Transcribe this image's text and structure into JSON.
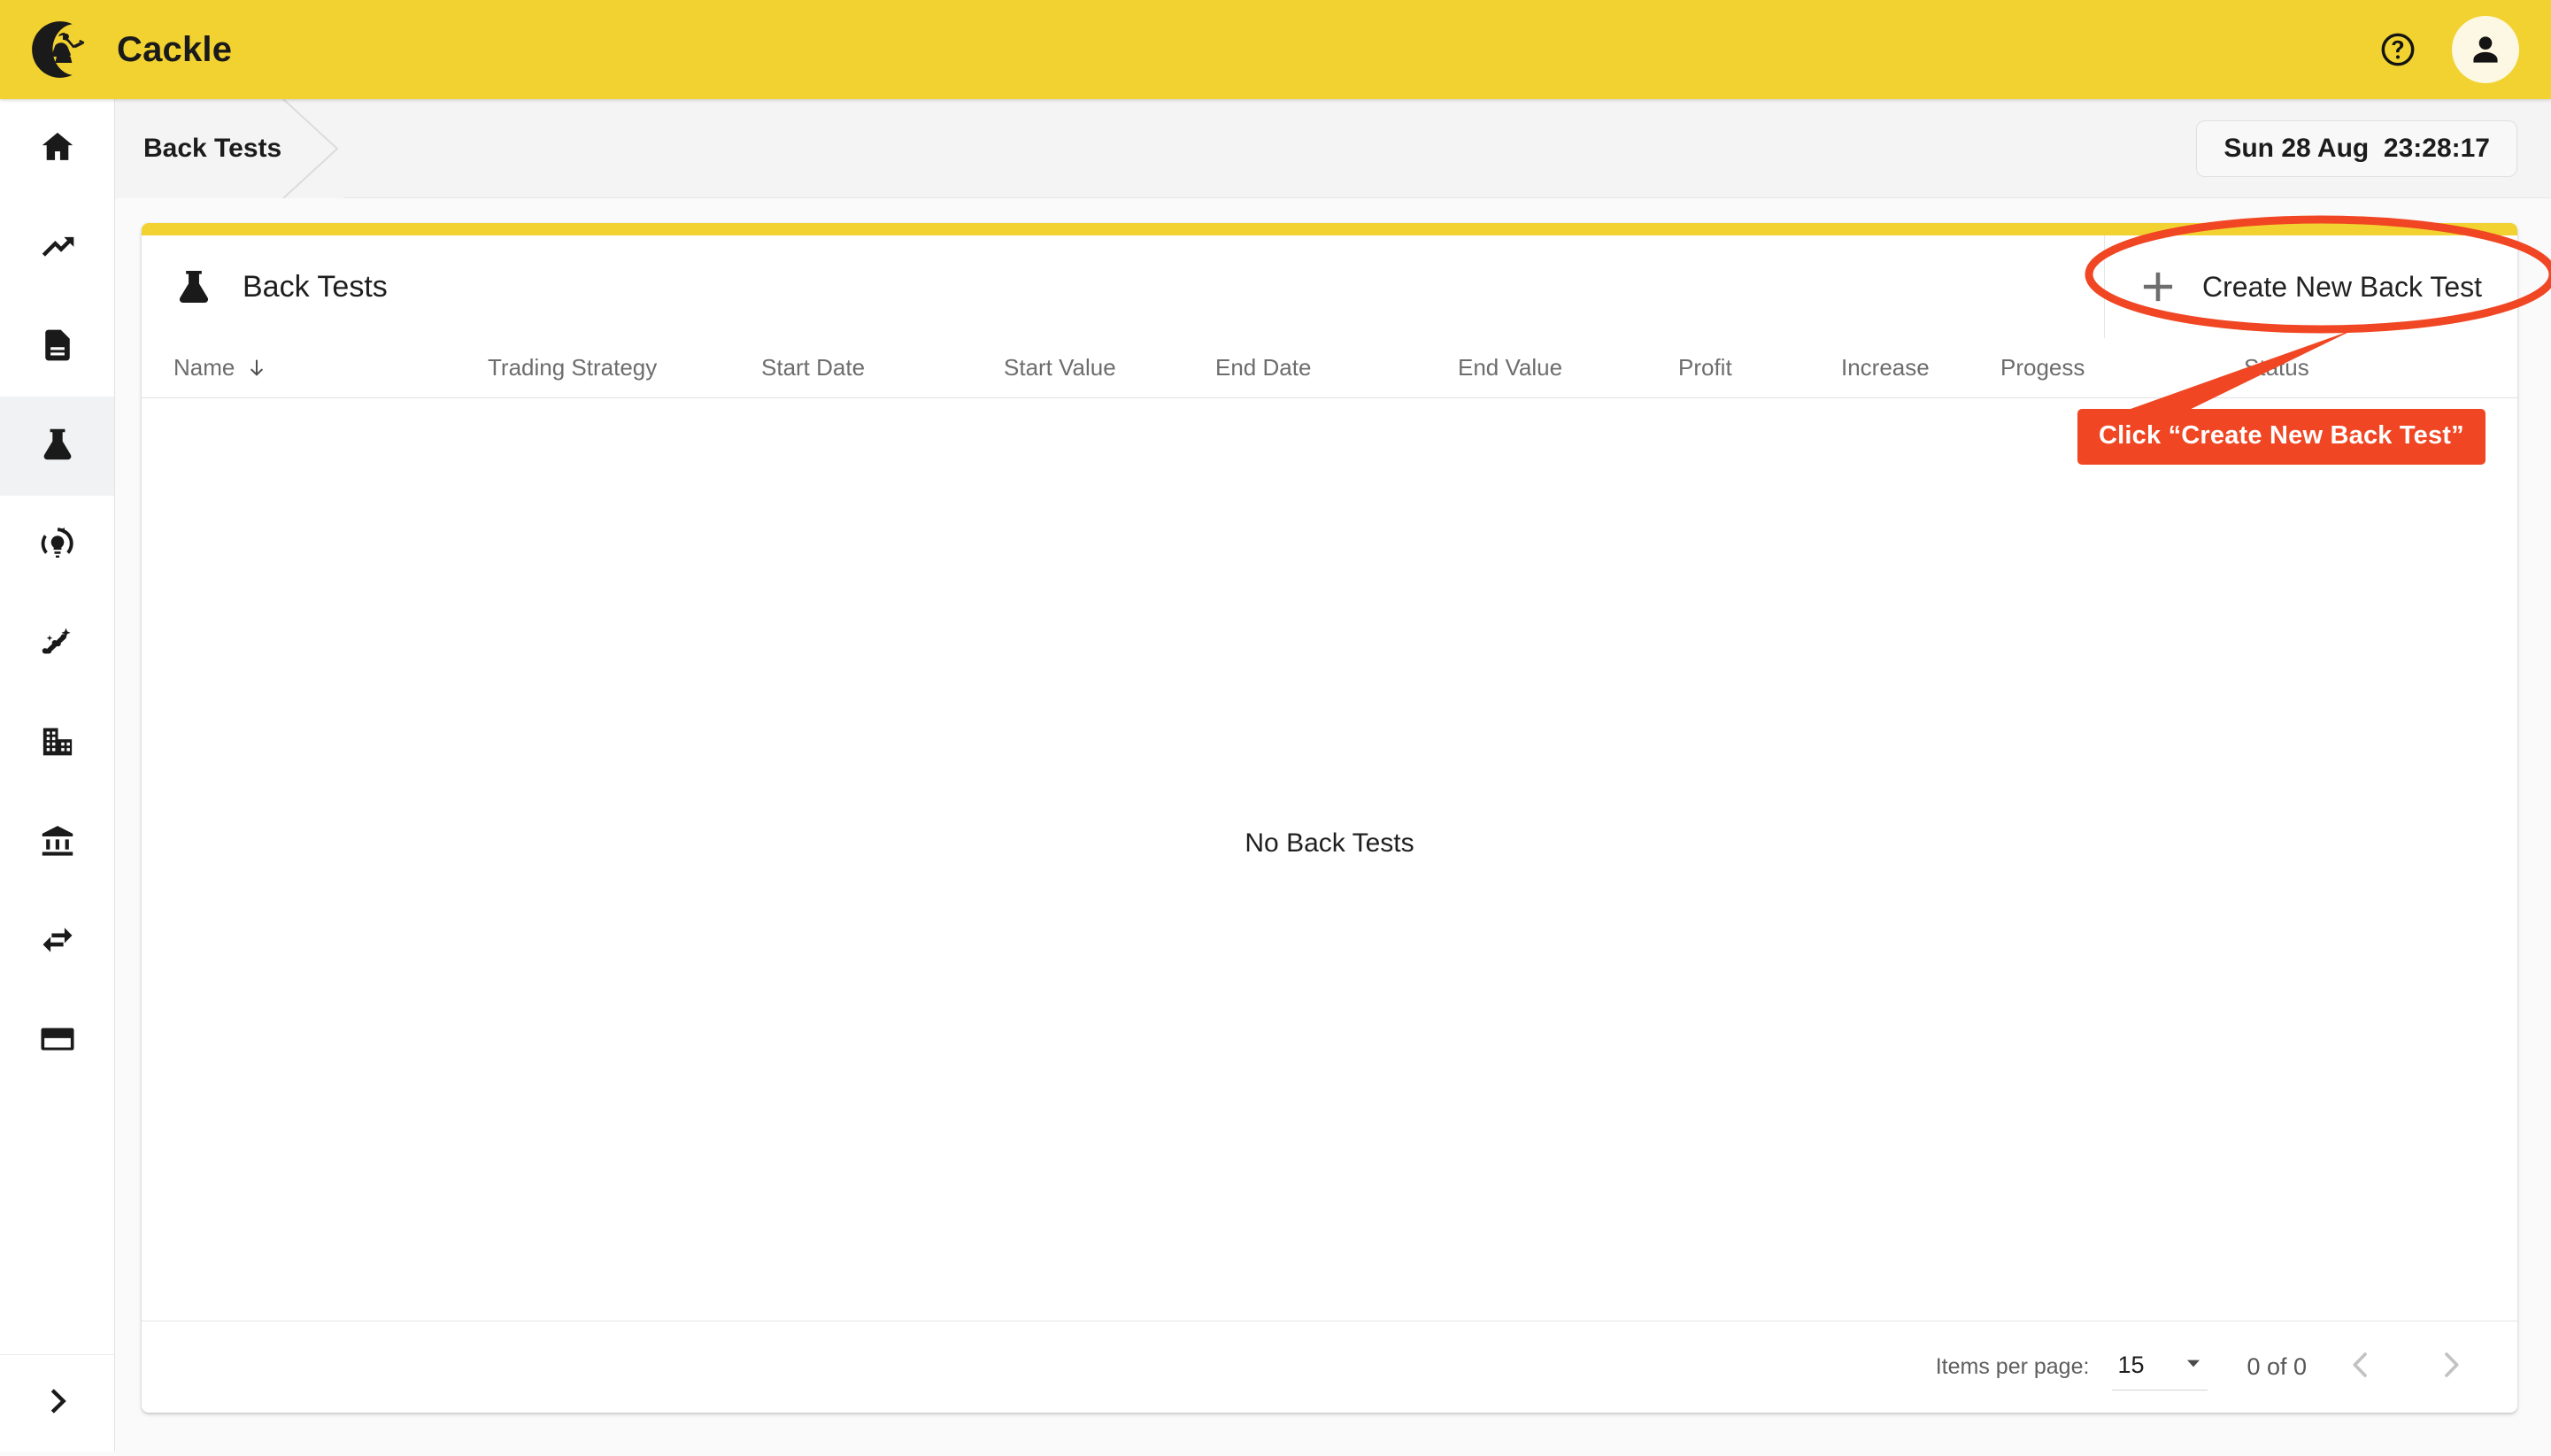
{
  "appbar": {
    "brand_name": "Cackle",
    "logo_icon": "witch-on-broom-moon-logo",
    "help_icon": "help-circle-icon",
    "avatar_icon": "person-avatar-icon",
    "background_color": "#f2d230"
  },
  "sidebar": {
    "items": [
      {
        "icon": "home-icon",
        "name": "home",
        "active": false
      },
      {
        "icon": "trending-up-icon",
        "name": "trending",
        "active": false
      },
      {
        "icon": "document-icon",
        "name": "documents",
        "active": false
      },
      {
        "icon": "flask-icon",
        "name": "back-tests",
        "active": true
      },
      {
        "icon": "refresh-bulb-icon",
        "name": "insights",
        "active": false
      },
      {
        "icon": "auto-graph-icon",
        "name": "auto-graph",
        "active": false
      },
      {
        "icon": "business-icon",
        "name": "business",
        "active": false
      },
      {
        "icon": "bank-icon",
        "name": "accounts",
        "active": false
      },
      {
        "icon": "swap-horizontal-icon",
        "name": "transfers",
        "active": false
      },
      {
        "icon": "credit-card-icon",
        "name": "payments",
        "active": false
      }
    ],
    "expand_icon": "chevron-right-icon"
  },
  "subheader": {
    "breadcrumb": "Back Tests",
    "clock": "Sun 28 Aug  23:28:17"
  },
  "card": {
    "accent_color": "#f2d230",
    "title": "Back Tests",
    "title_icon": "flask-icon",
    "create_button": {
      "label": "Create New Back Test",
      "icon": "plus-icon"
    },
    "table": {
      "columns": [
        {
          "label": "Name",
          "sorted": true,
          "sort_icon": "arrow-down-icon"
        },
        {
          "label": "Trading Strategy",
          "sorted": false
        },
        {
          "label": "Start Date",
          "sorted": false
        },
        {
          "label": "Start Value",
          "sorted": false
        },
        {
          "label": "End Date",
          "sorted": false
        },
        {
          "label": "End Value",
          "sorted": false
        },
        {
          "label": "Profit",
          "sorted": false
        },
        {
          "label": "Increase",
          "sorted": false
        },
        {
          "label": "Progess",
          "sorted": false
        },
        {
          "label": "Status",
          "sorted": false
        }
      ],
      "rows": [],
      "empty_message": "No Back Tests"
    },
    "paginator": {
      "items_per_page_label": "Items per page:",
      "items_per_page_value": "15",
      "dropdown_icon": "triangle-down-icon",
      "range_label": "0 of 0",
      "prev_icon": "chevron-left-icon",
      "next_icon": "chevron-right-icon"
    }
  },
  "annotation": {
    "label": "Click “Create New Back Test”",
    "color": "#f04623",
    "highlight_shape": "ellipse",
    "pointer": "arrow"
  }
}
